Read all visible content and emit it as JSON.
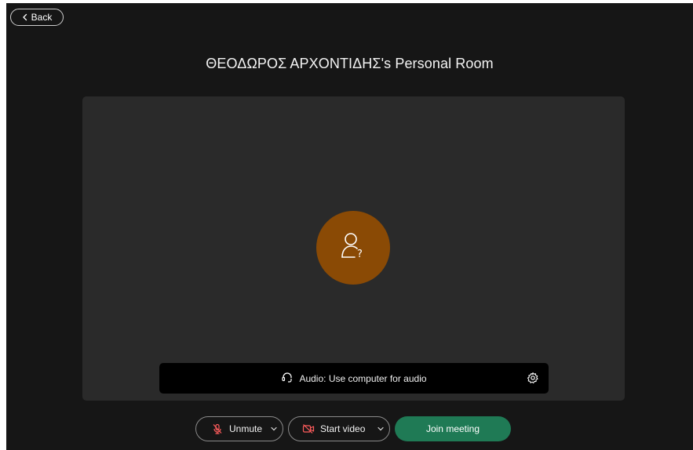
{
  "header": {
    "back_label": "Back"
  },
  "room": {
    "title": "ΘΕΟΔΩΡΟΣ ΑΡΧΟΝΤΙΔΗΣ's Personal Room"
  },
  "preview": {
    "avatar_icon": "unknown-user-icon",
    "avatar_color": "#8a4a05"
  },
  "audio": {
    "label": "Audio: Use computer for audio",
    "icon": "headset-icon",
    "settings_icon": "gear-icon"
  },
  "controls": {
    "unmute_label": "Unmute",
    "start_video_label": "Start video",
    "join_label": "Join meeting",
    "join_color": "#1f7a55"
  }
}
